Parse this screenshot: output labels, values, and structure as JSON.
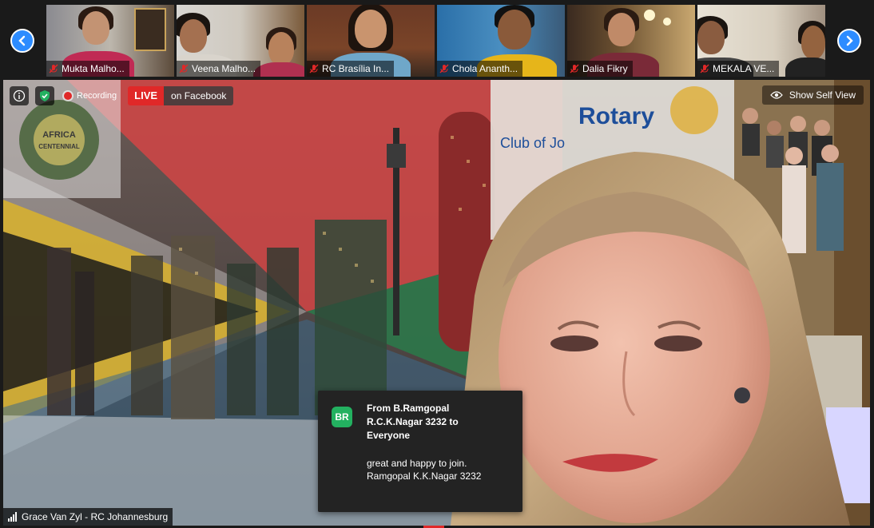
{
  "filmstrip": {
    "prev_icon": "chevron-left-icon",
    "next_icon": "chevron-right-icon",
    "participants": [
      {
        "name": "Mukta Malho...",
        "muted": true
      },
      {
        "name": "Veena Malho...",
        "muted": true
      },
      {
        "name": "RC Brasília In...",
        "muted": true
      },
      {
        "name": "Chola Ananth...",
        "muted": true
      },
      {
        "name": "Dalia Fikry",
        "muted": true
      },
      {
        "name": "MEKALA VE...",
        "muted": true
      }
    ]
  },
  "main_video": {
    "recording_label": "Recording",
    "live_label": "LIVE",
    "live_destination": "on Facebook",
    "self_view_label": "Show Self View",
    "speaker_name": "Grace Van Zyl - RC Johannesburg",
    "background_text": {
      "rotary": "Rotary",
      "club": "Club of Jo",
      "logo_line1": "AFRICA",
      "logo_line2": "CENTENNIAL"
    }
  },
  "chat_popup": {
    "avatar_initials": "BR",
    "from_line": "From B.Ramgopal R.C.K.Nagar 3232 to Everyone",
    "message": "great and happy to join. Ramgopal K.K.Nagar 3232"
  },
  "colors": {
    "accent": "#2d8cff",
    "live": "#e02828",
    "avatar": "#23b160",
    "mic_muted": "#e02828"
  }
}
